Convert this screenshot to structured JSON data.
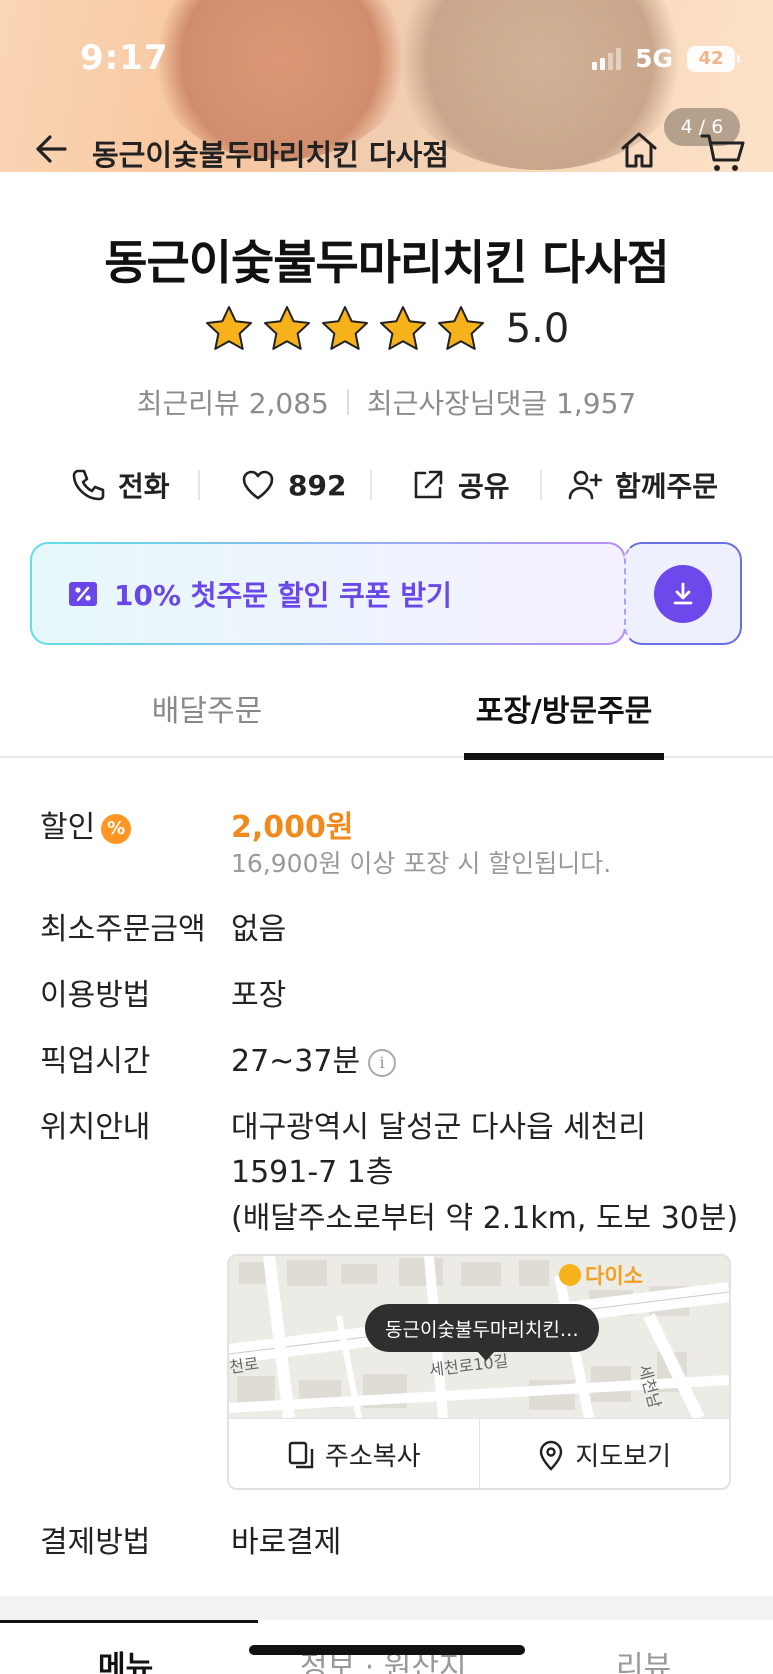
{
  "status_bar": {
    "time": "9:17",
    "network": "5G",
    "battery": "42"
  },
  "header": {
    "title": "동근이숯불두마리치킨 다사점",
    "photo_counter": "4 / 6"
  },
  "store": {
    "name": "동근이숯불두마리치킨 다사점",
    "rating": "5.0",
    "stars": 5,
    "recent_reviews": "최근리뷰 2,085",
    "owner_replies": "최근사장님댓글 1,957"
  },
  "actions": {
    "call": "전화",
    "likes": "892",
    "share": "공유",
    "group_order": "함께주문"
  },
  "coupon": {
    "text": "10% 첫주문 할인 쿠폰 받기"
  },
  "order_tabs": {
    "delivery": "배달주문",
    "takeout": "포장/방문주문",
    "active": "takeout"
  },
  "info": {
    "discount": {
      "label": "할인",
      "badge": "%",
      "amount": "2,000원",
      "note": "16,900원 이상 포장 시 할인됩니다."
    },
    "min_order": {
      "label": "최소주문금액",
      "value": "없음"
    },
    "method": {
      "label": "이용방법",
      "value": "포장"
    },
    "pickup": {
      "label": "픽업시간",
      "value": "27~37분",
      "info_icon": "i"
    },
    "location": {
      "label": "위치안내",
      "line1": "대구광역시 달성군 다사읍 세천리",
      "line2": "1591-7 1층",
      "line3": "(배달주소로부터 약 2.1km, 도보 30분)"
    },
    "payment": {
      "label": "결제방법",
      "value": "바로결제"
    }
  },
  "map": {
    "tooltip": "동근이숯불두마리치킨…",
    "poi": "다이소",
    "road_left": "천로",
    "road_center": "세천로10길",
    "road_right": "세천남",
    "copy_address": "주소복사",
    "view_map": "지도보기"
  },
  "bottom_tabs": {
    "menu": "메뉴",
    "info": "정보 · 원산지",
    "review": "리뷰"
  },
  "colors": {
    "accent_orange": "#f18a1d",
    "coupon_purple": "#6a47e8",
    "star_yellow": "#f7b21b"
  }
}
